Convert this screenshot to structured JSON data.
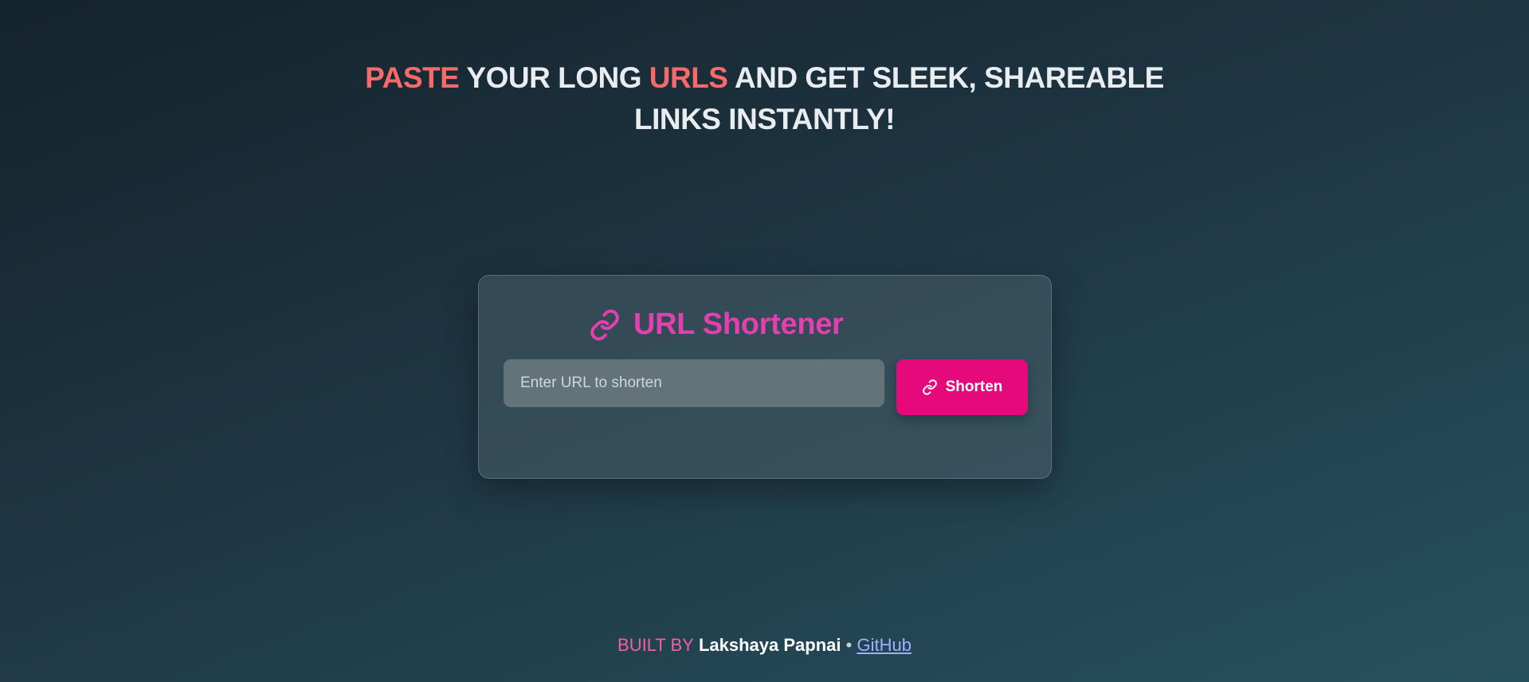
{
  "headline": {
    "line1": [
      {
        "text": "PASTE",
        "accent": true
      },
      {
        "text": " YOUR LONG ",
        "accent": false
      },
      {
        "text": "URLS",
        "accent": true
      },
      {
        "text": " AND GET SLEEK, SHAREABLE",
        "accent": false
      }
    ],
    "line2": "LINKS INSTANTLY!"
  },
  "card": {
    "title_icon": "link-icon",
    "title": "URL Shortener",
    "input": {
      "placeholder": "Enter URL to shorten",
      "value": ""
    },
    "button": {
      "icon": "link-icon",
      "label": "Shorten"
    }
  },
  "footer": {
    "built_by": "BUILT BY",
    "author": "Lakshaya Papnai",
    "separator": "•",
    "link_label": "GitHub"
  },
  "colors": {
    "accent_red": "#f76a6a",
    "title_pink": "#e43fae",
    "button_pink": "#e6097b",
    "link_blue": "#9fb0ff"
  }
}
